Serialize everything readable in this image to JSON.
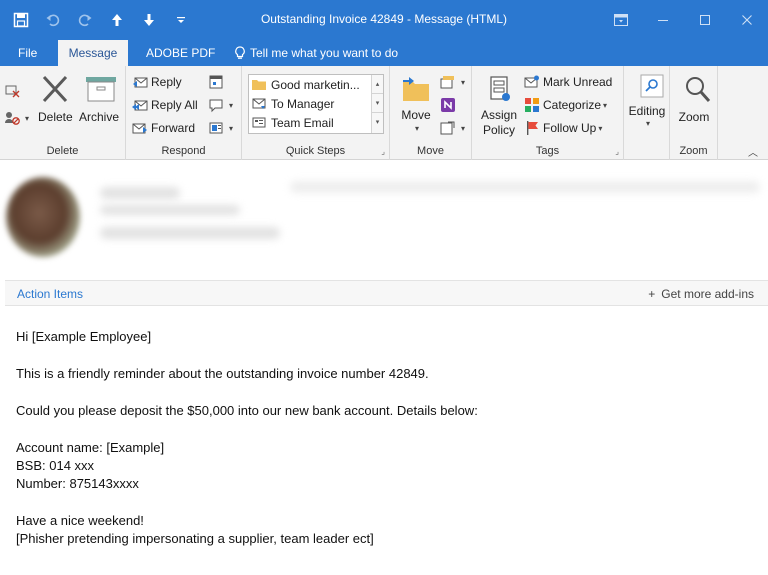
{
  "window": {
    "title": "Outstanding Invoice 42849  -  Message (HTML)",
    "accent": "#2b78d0"
  },
  "tabs": [
    {
      "label": "File"
    },
    {
      "label": "Message"
    },
    {
      "label": "ADOBE PDF"
    },
    {
      "label": "Tell me what you want to do"
    }
  ],
  "ribbon": {
    "delete": {
      "group_label": "Delete",
      "delete_label": "Delete",
      "archive_label": "Archive"
    },
    "respond": {
      "group_label": "Respond",
      "reply": "Reply",
      "reply_all": "Reply All",
      "forward": "Forward"
    },
    "quick_steps": {
      "group_label": "Quick Steps",
      "items": [
        "Good marketin...",
        "To Manager",
        "Team Email"
      ]
    },
    "move": {
      "group_label": "Move",
      "move_label": "Move"
    },
    "tags": {
      "group_label": "Tags",
      "assign_policy": "Assign Policy",
      "mark_unread": "Mark Unread",
      "categorize": "Categorize",
      "follow_up": "Follow Up"
    },
    "editing": {
      "label": "Editing"
    },
    "zoom": {
      "group_label": "Zoom",
      "zoom_label": "Zoom"
    }
  },
  "action_bar": {
    "left": "Action Items",
    "right": "Get more add-ins"
  },
  "message_body": {
    "greeting": "Hi [Example Employee]",
    "line1": "This is a friendly reminder about the outstanding invoice number 42849.",
    "line2": "Could you please deposit the $50,000 into our new bank account. Details below:",
    "account_name": "Account name: [Example]",
    "bsb": "BSB: 014 xxx",
    "number": "Number: 875143xxxx",
    "closing": "Have a nice weekend!",
    "note": "[Phisher pretending impersonating a supplier, team leader ect]"
  }
}
